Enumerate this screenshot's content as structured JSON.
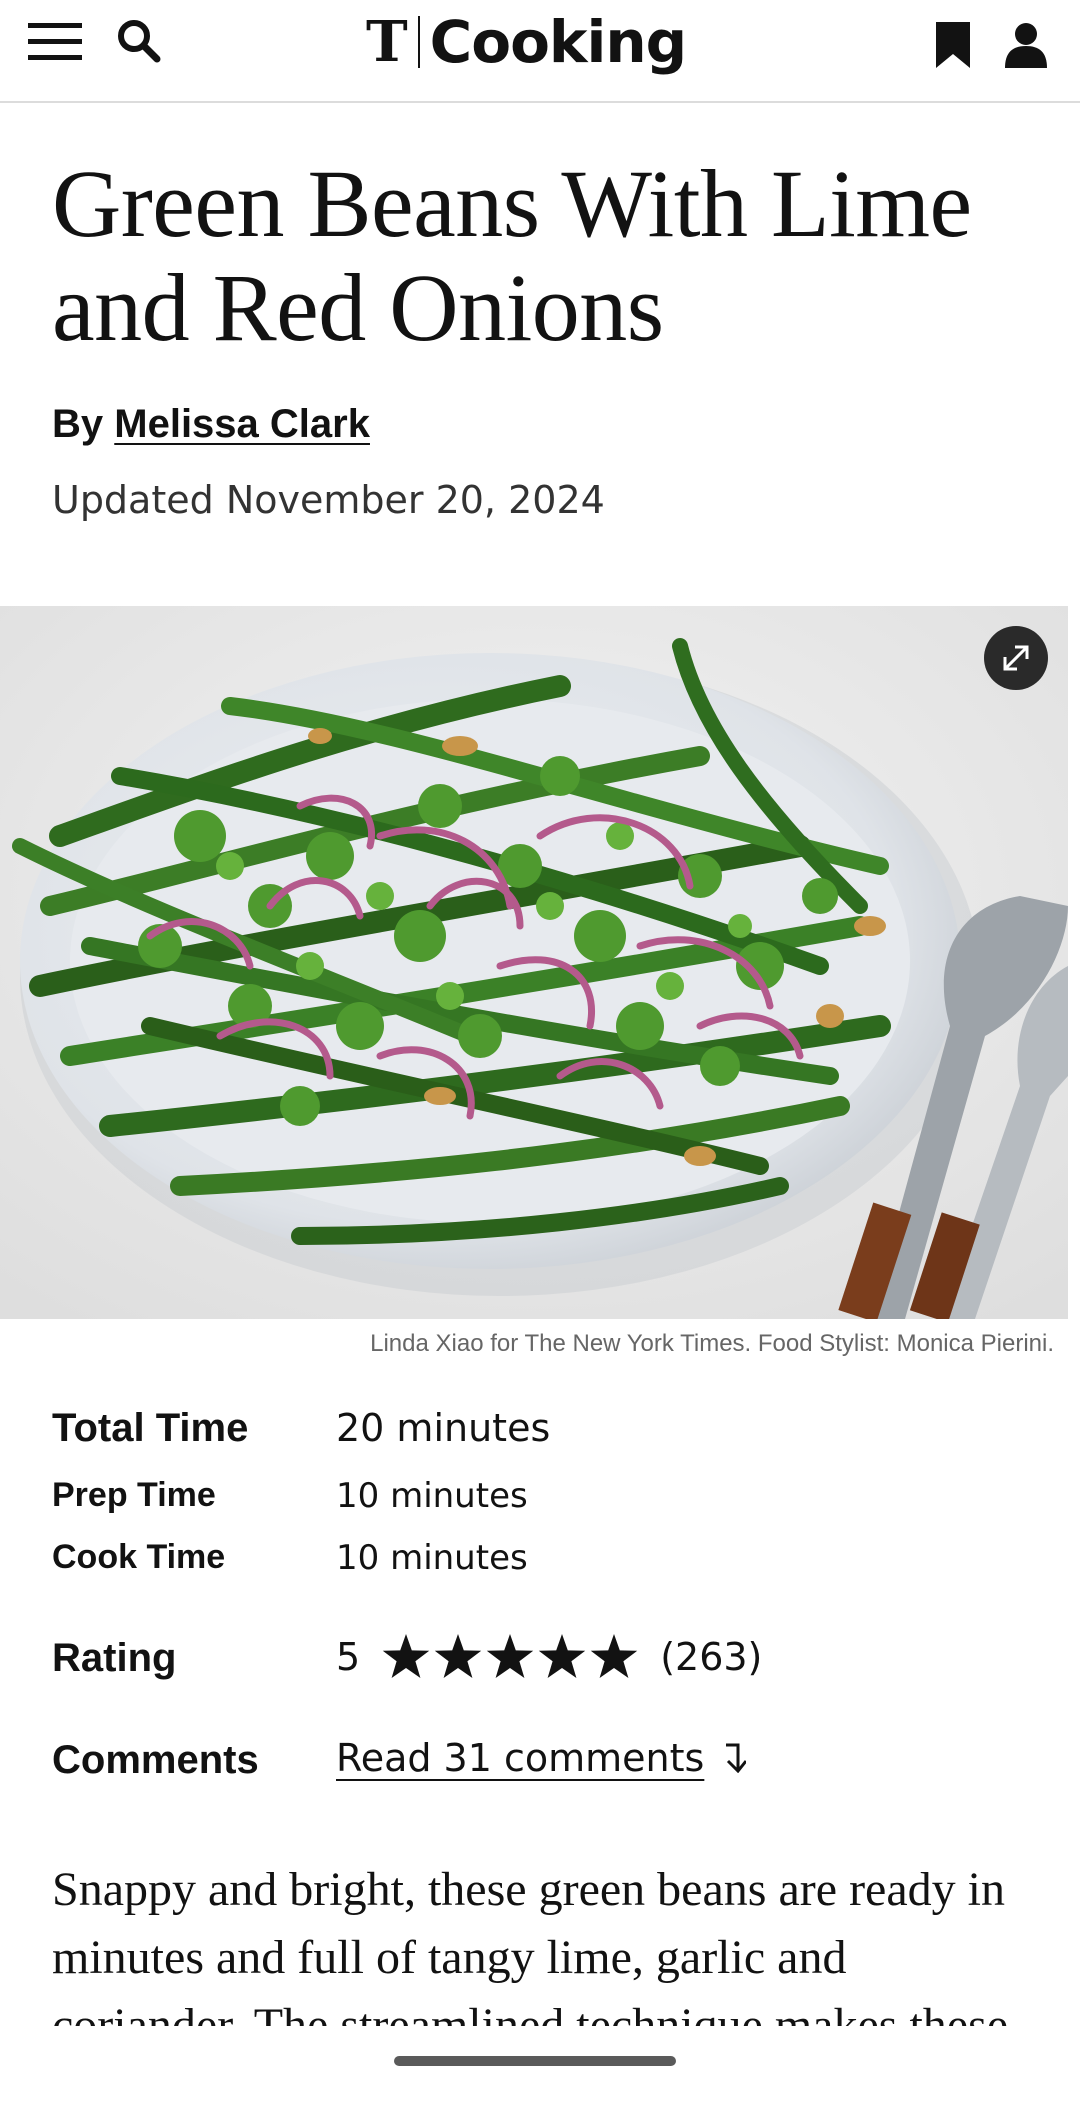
{
  "header": {
    "logo_mark": "T",
    "logo_word": "Cooking",
    "icons": {
      "menu": "hamburger-icon",
      "search": "search-icon",
      "bookmark": "bookmark-icon",
      "account": "account-icon"
    }
  },
  "recipe": {
    "title": "Green Beans With Lime and Red Onions",
    "byline_prefix": "By",
    "author": "Melissa Clark",
    "updated": "Updated November 20, 2024",
    "photo_credit": "Linda Xiao for The New York Times. Food Stylist: Monica Pierini.",
    "hero_icon": "expand-icon"
  },
  "stats": {
    "total_label": "Total Time",
    "total_value": "20 minutes",
    "prep_label": "Prep Time",
    "prep_value": "10 minutes",
    "cook_label": "Cook Time",
    "cook_value": "10 minutes",
    "rating_label": "Rating",
    "rating_value": "5",
    "rating_stars": 5,
    "rating_count": "(263)",
    "comments_label": "Comments",
    "comments_link": "Read 31 comments"
  },
  "description": "Snappy and bright, these green beans are ready in minutes and full of tangy lime, garlic and coriander. The streamlined technique makes these",
  "colors": {
    "text": "#121212",
    "divider": "#dcdcdc",
    "credit": "#666666"
  }
}
